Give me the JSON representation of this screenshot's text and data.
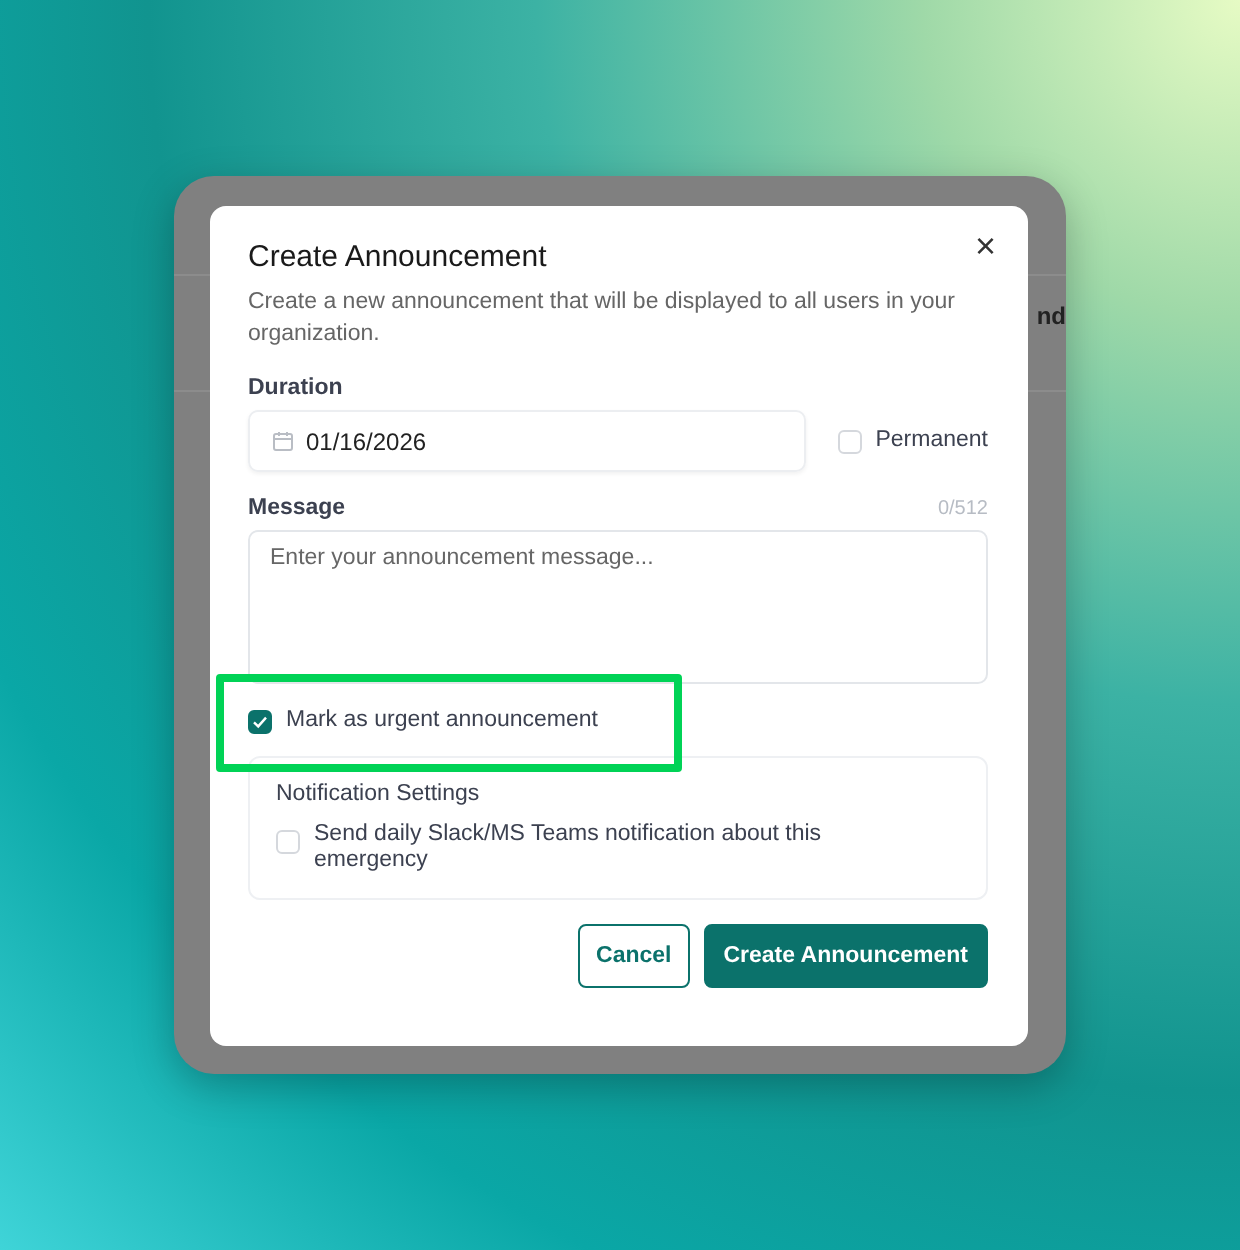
{
  "background_text": "nd",
  "dialog": {
    "title": "Create Announcement",
    "close": "×",
    "description": "Create a new announcement that will be displayed to all users in your organization.",
    "duration": {
      "label": "Duration",
      "date": "01/16/2026",
      "permanent": {
        "label": "Permanent",
        "checked": false
      }
    },
    "message": {
      "label": "Message",
      "counter": "0/512",
      "placeholder": "Enter your announcement message..."
    },
    "urgent": {
      "label": "Mark as urgent announcement",
      "checked": true,
      "highlighted": true
    },
    "notification_settings": {
      "title": "Notification Settings",
      "option": {
        "label": "Send daily Slack/MS Teams notification about this emergency",
        "checked": false
      }
    },
    "buttons": [
      {
        "label": "Cancel",
        "kind": "secondary"
      },
      {
        "label": "Create Announcement",
        "kind": "primary"
      }
    ]
  }
}
